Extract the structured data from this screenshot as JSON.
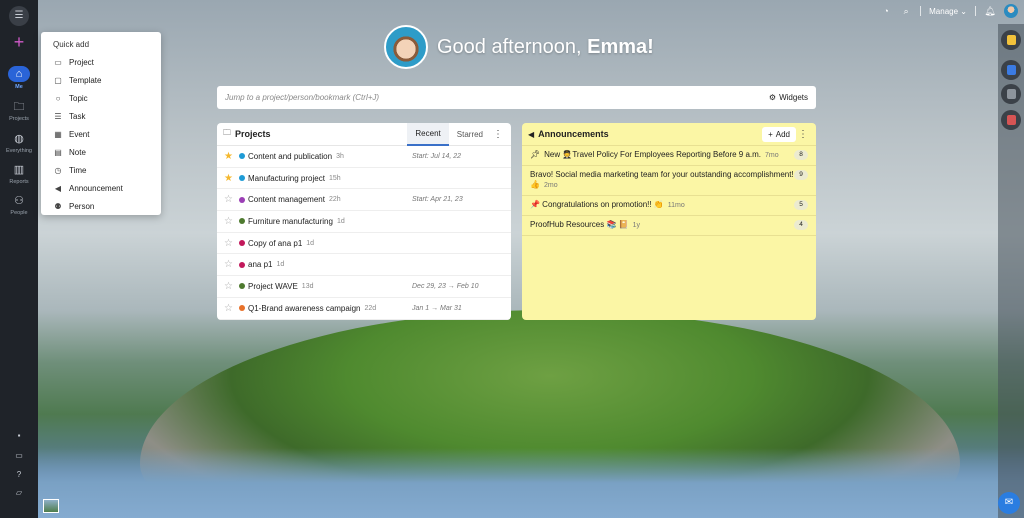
{
  "greeting": {
    "prefix": "Good afternoon, ",
    "name": "Emma!"
  },
  "search": {
    "placeholder": "Jump to a project/person/bookmark (Ctrl+J)",
    "widgets_label": "Widgets"
  },
  "topbar": {
    "manage_label": "Manage"
  },
  "sidebar": {
    "items": [
      {
        "label": "Me",
        "icon": "home-icon"
      },
      {
        "label": "Projects",
        "icon": "folder-icon"
      },
      {
        "label": "Everything",
        "icon": "globe-icon"
      },
      {
        "label": "Reports",
        "icon": "chart-icon"
      },
      {
        "label": "People",
        "icon": "people-icon"
      }
    ]
  },
  "quick_add": {
    "title": "Quick add",
    "items": [
      {
        "label": "Project",
        "icon": "folder-icon"
      },
      {
        "label": "Template",
        "icon": "template-icon"
      },
      {
        "label": "Topic",
        "icon": "chat-icon"
      },
      {
        "label": "Task",
        "icon": "task-list-icon"
      },
      {
        "label": "Event",
        "icon": "calendar-icon"
      },
      {
        "label": "Note",
        "icon": "note-icon"
      },
      {
        "label": "Time",
        "icon": "clock-icon"
      },
      {
        "label": "Announcement",
        "icon": "megaphone-icon"
      },
      {
        "label": "Person",
        "icon": "add-person-icon"
      }
    ]
  },
  "projects": {
    "title": "Projects",
    "tabs": [
      "Recent",
      "Starred"
    ],
    "rows": [
      {
        "name": "Content and publication",
        "age": "3h",
        "dates": "Start: Jul 14, 22",
        "starred": true,
        "color": "#1e9bd6"
      },
      {
        "name": "Manufacturing project",
        "age": "15h",
        "dates": "",
        "starred": true,
        "color": "#1e9bd6"
      },
      {
        "name": "Content management",
        "age": "22h",
        "dates": "Start: Apr 21, 23",
        "starred": false,
        "color": "#9b3fb5"
      },
      {
        "name": "Furniture manufacturing",
        "age": "1d",
        "dates": "",
        "starred": false,
        "color": "#4e7a2f"
      },
      {
        "name": "Copy of ana p1",
        "age": "1d",
        "dates": "",
        "starred": false,
        "color": "#c2185b"
      },
      {
        "name": "ana p1",
        "age": "1d",
        "dates": "",
        "starred": false,
        "color": "#c2185b"
      },
      {
        "name": "Project WAVE",
        "age": "13d",
        "dates": "Dec 29, 23 → Feb 10",
        "starred": false,
        "color": "#4e7a2f"
      },
      {
        "name": "Q1-Brand awareness campaign",
        "age": "22d",
        "dates": "Jan 1 → Mar 31",
        "starred": false,
        "color": "#e8712a"
      }
    ]
  },
  "announcements": {
    "title": "Announcements",
    "add_label": "Add",
    "rows": [
      {
        "text": "New 🧑‍✈️Travel Policy For Employees Reporting Before 9 a.m.",
        "ago": "7mo",
        "count": "8",
        "pinned": true
      },
      {
        "text": "Bravo! Social media marketing team for your outstanding accomplishment!👍",
        "ago": "2mo",
        "count": "9",
        "pinned": false
      },
      {
        "text": "📌 Congratulations on promotion!! 👏",
        "ago": "11mo",
        "count": "5",
        "pinned": false
      },
      {
        "text": "ProofHub Resources 📚 📔",
        "ago": "1y",
        "count": "4",
        "pinned": false
      }
    ]
  },
  "colors": {
    "rail": "#1f2329",
    "accent": "#2a64d8",
    "plus": "#d05ac9",
    "announcements_bg": "#fbf6a5"
  }
}
